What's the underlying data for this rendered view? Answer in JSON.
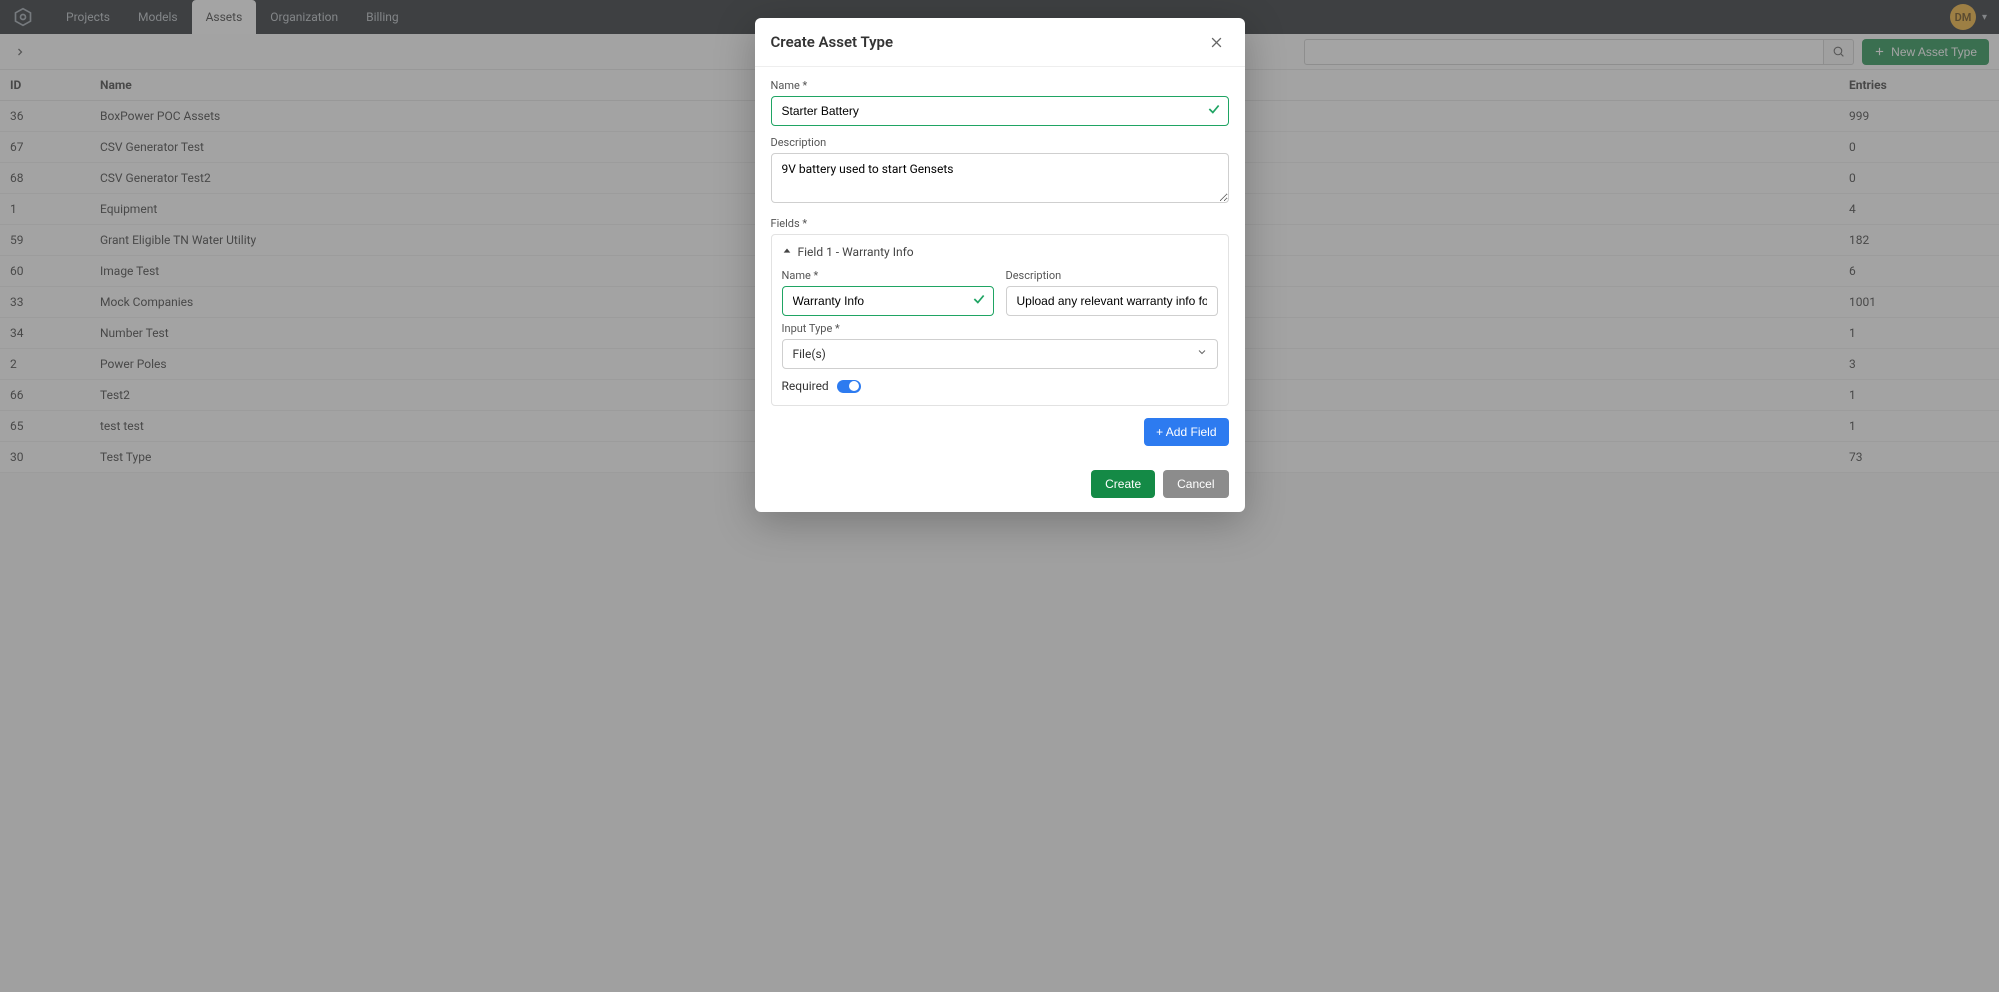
{
  "nav": {
    "tabs": [
      "Projects",
      "Models",
      "Assets",
      "Organization",
      "Billing"
    ],
    "active_index": 2,
    "avatar_initials": "DM"
  },
  "toolbar": {
    "search_placeholder": "",
    "new_button_label": "New Asset Type"
  },
  "table": {
    "headers": {
      "id": "ID",
      "name": "Name",
      "entries": "Entries"
    },
    "rows": [
      {
        "id": "36",
        "name": "BoxPower POC Assets",
        "entries": "999"
      },
      {
        "id": "67",
        "name": "CSV Generator Test",
        "entries": "0"
      },
      {
        "id": "68",
        "name": "CSV Generator Test2",
        "entries": "0"
      },
      {
        "id": "1",
        "name": "Equipment",
        "entries": "4"
      },
      {
        "id": "59",
        "name": "Grant Eligible TN Water Utility",
        "entries": "182"
      },
      {
        "id": "60",
        "name": "Image Test",
        "entries": "6"
      },
      {
        "id": "33",
        "name": "Mock Companies",
        "entries": "1001"
      },
      {
        "id": "34",
        "name": "Number Test",
        "entries": "1"
      },
      {
        "id": "2",
        "name": "Power Poles",
        "entries": "3"
      },
      {
        "id": "66",
        "name": "Test2",
        "entries": "1"
      },
      {
        "id": "65",
        "name": "test test",
        "entries": "1"
      },
      {
        "id": "30",
        "name": "Test Type",
        "entries": "73"
      }
    ]
  },
  "modal": {
    "title": "Create Asset Type",
    "name_label": "Name *",
    "name_value": "Starter Battery",
    "description_label": "Description",
    "description_value": "9V battery used to start Gensets",
    "fields_label": "Fields *",
    "field1": {
      "header": "Field 1 - Warranty Info",
      "name_label": "Name *",
      "name_value": "Warranty Info",
      "desc_label": "Description",
      "desc_value": "Upload any relevant warranty info for the Asset",
      "input_type_label": "Input Type *",
      "input_type_value": "File(s)",
      "required_label": "Required",
      "required_on": true
    },
    "add_field_label": "+ Add Field",
    "create_label": "Create",
    "cancel_label": "Cancel"
  }
}
